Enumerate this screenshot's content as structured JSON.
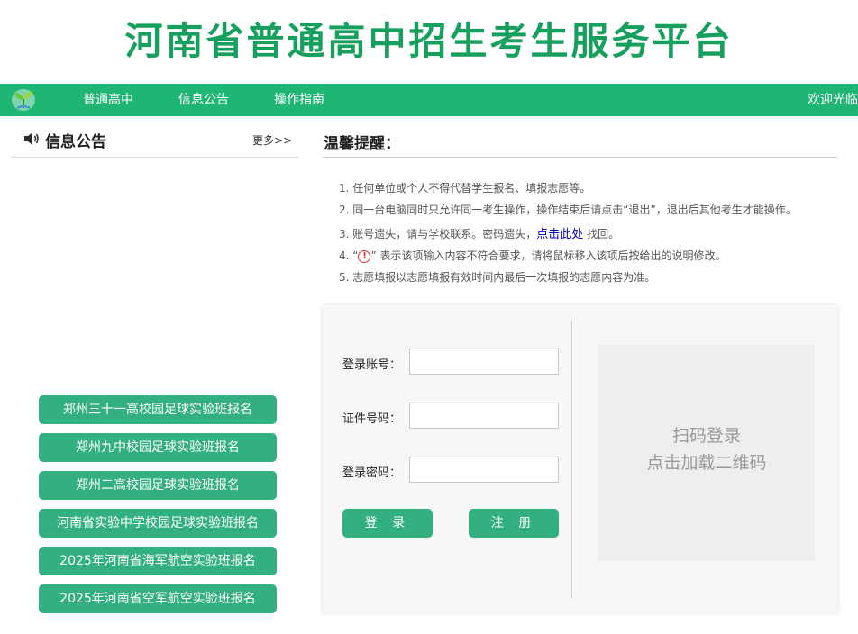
{
  "banner": {
    "title": "河南省普通高中招生考生服务平台"
  },
  "colors": {
    "brand_green": "#1fb574",
    "button_green": "#33b07f",
    "title_green": "#17a05d",
    "link_blue": "#0000cc",
    "warn_red": "#d9302c"
  },
  "nav": {
    "logo_icon": "sprout-logo-icon",
    "items": [
      "普通高中",
      "信息公告",
      "操作指南"
    ],
    "welcome": "欢迎光临"
  },
  "notice": {
    "icon": "speaker-icon",
    "title": "信息公告",
    "more": "更多>>",
    "buttons": [
      "郑州三十一高校园足球实验班报名",
      "郑州九中校园足球实验班报名",
      "郑州二高校园足球实验班报名",
      "河南省实验中学校园足球实验班报名",
      "2025年河南省海军航空实验班报名",
      "2025年河南省空军航空实验班报名"
    ]
  },
  "tips": {
    "title": "温馨提醒：",
    "items": [
      "1. 任何单位或个人不得代替学生报名、填报志愿等。",
      "2. 同一台电脑同时只允许同一考生操作，操作结束后请点击“退出”，退出后其他考生才能操作。",
      "5. 志愿填报以志愿填报有效时间内最后一次填报的志愿内容为准。"
    ],
    "item3": {
      "before": "3. 账号遗失，请与学校联系。密码遗失，",
      "link": "点击此处",
      "after": " 找回。"
    },
    "item4": {
      "before": "4. “",
      "icon_text": "!",
      "after": "” 表示该项输入内容不符合要求，请将鼠标移入该项后按给出的说明修改。"
    }
  },
  "login": {
    "account_label": "登录账号：",
    "account_value": "",
    "id_label": "证件号码：",
    "id_value": "",
    "password_label": "登录密码：",
    "password_value": "",
    "login_button": "登 录",
    "register_button": "注 册",
    "qr_line1": "扫码登录",
    "qr_line2": "点击加载二维码"
  }
}
